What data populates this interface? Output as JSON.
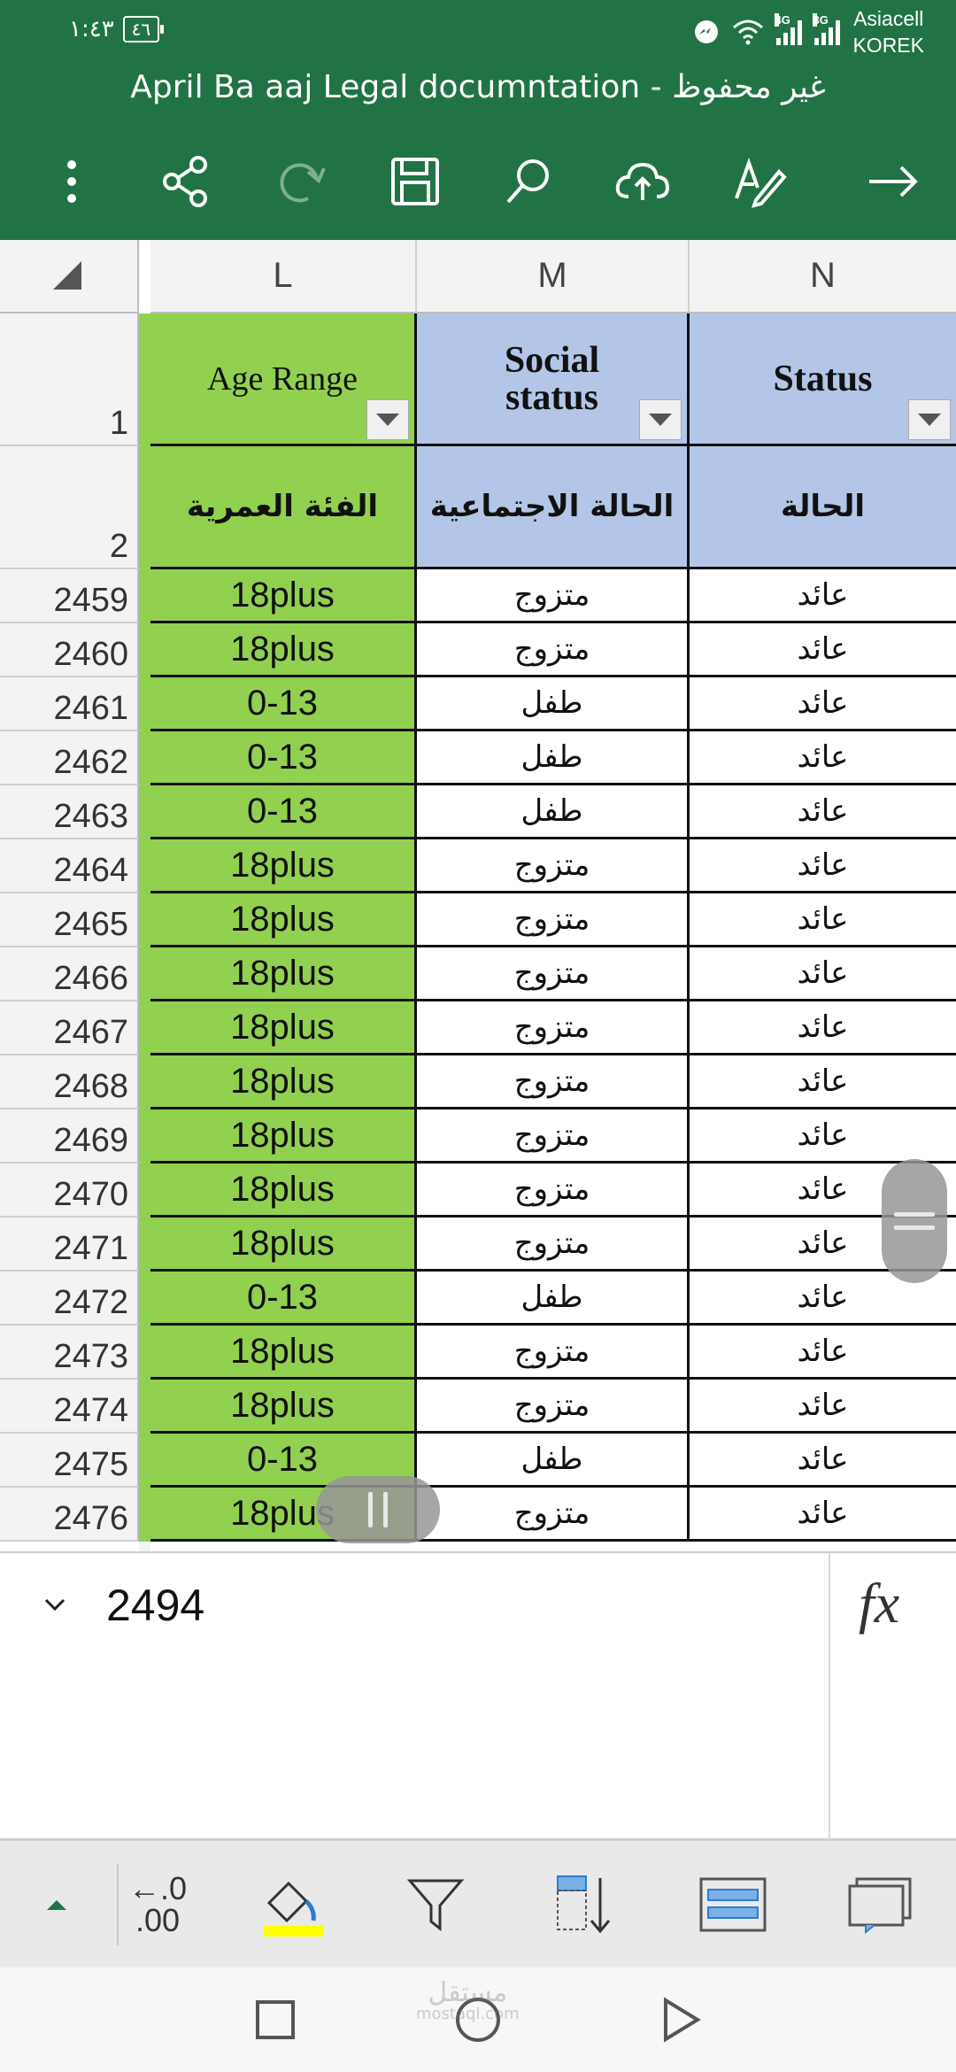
{
  "status_bar": {
    "time": "١:٤٣",
    "battery": "٤٦",
    "network_4g": "4G",
    "network_3g": "3G",
    "carrier_line1": "Asiacell",
    "carrier_line2": "KOREK"
  },
  "title": "April Ba aaj Legal documntation - غير محفوظ",
  "toolbar": {
    "icons": [
      "more-icon",
      "share-icon",
      "redo-icon",
      "save-icon",
      "search-icon",
      "cloud-upload-icon",
      "draw-icon",
      "forward-arrow-icon"
    ]
  },
  "columns": [
    "L",
    "M",
    "N"
  ],
  "header_rows": {
    "row1": {
      "number": "1",
      "L": "Age Range",
      "M_line1": "Social",
      "M_line2": "status",
      "N": "Status"
    },
    "row2": {
      "number": "2",
      "L": "الفئة العمرية",
      "M": "الحالة الاجتماعية",
      "N": "الحالة"
    }
  },
  "rows": [
    {
      "n": "2459",
      "L": "18plus",
      "M": "متزوج",
      "N": "عائد"
    },
    {
      "n": "2460",
      "L": "18plus",
      "M": "متزوج",
      "N": "عائد"
    },
    {
      "n": "2461",
      "L": "0-13",
      "M": "طفل",
      "N": "عائد"
    },
    {
      "n": "2462",
      "L": "0-13",
      "M": "طفل",
      "N": "عائد"
    },
    {
      "n": "2463",
      "L": "0-13",
      "M": "طفل",
      "N": "عائد"
    },
    {
      "n": "2464",
      "L": "18plus",
      "M": "متزوج",
      "N": "عائد"
    },
    {
      "n": "2465",
      "L": "18plus",
      "M": "متزوج",
      "N": "عائد"
    },
    {
      "n": "2466",
      "L": "18plus",
      "M": "متزوج",
      "N": "عائد"
    },
    {
      "n": "2467",
      "L": "18plus",
      "M": "متزوج",
      "N": "عائد"
    },
    {
      "n": "2468",
      "L": "18plus",
      "M": "متزوج",
      "N": "عائد"
    },
    {
      "n": "2469",
      "L": "18plus",
      "M": "متزوج",
      "N": "عائد"
    },
    {
      "n": "2470",
      "L": "18plus",
      "M": "متزوج",
      "N": "عائد"
    },
    {
      "n": "2471",
      "L": "18plus",
      "M": "متزوج",
      "N": "عائد"
    },
    {
      "n": "2472",
      "L": "0-13",
      "M": "طفل",
      "N": "عائد"
    },
    {
      "n": "2473",
      "L": "18plus",
      "M": "متزوج",
      "N": "عائد"
    },
    {
      "n": "2474",
      "L": "18plus",
      "M": "متزوج",
      "N": "عائد"
    },
    {
      "n": "2475",
      "L": "0-13",
      "M": "طفل",
      "N": "عائد"
    },
    {
      "n": "2476",
      "L": "18plus",
      "M": "متزوج",
      "N": "عائد"
    }
  ],
  "formula_bar": {
    "value": "2494",
    "fx_label": "fx"
  },
  "ribbon": {
    "icons": [
      "expand-up-icon",
      "decrease-decimal-icon",
      "fill-color-icon",
      "filter-icon",
      "sort-icon",
      "wrap-text-icon",
      "comment-icon"
    ],
    "decimal_top": "←.0",
    "decimal_bottom": ".00",
    "fill_color": "#ffff00"
  },
  "watermark": {
    "line1": "مستقل",
    "line2": "mostaql.com"
  },
  "colors": {
    "header_green": "#217346",
    "cell_green": "#92d050",
    "cell_blue": "#b4c6e7"
  }
}
